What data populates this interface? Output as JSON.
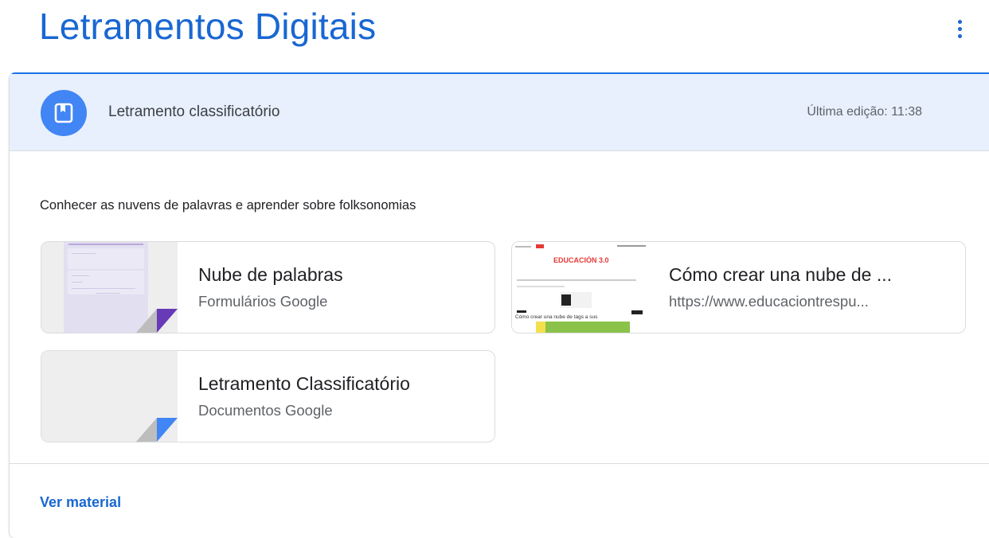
{
  "topic": {
    "title": "Letramentos Digitais"
  },
  "material": {
    "title": "Letramento classificatório",
    "last_edit": "Última edição: 11:38",
    "description": "Conhecer as nuvens de palavras e aprender sobre folksonomias",
    "view_label": "Ver material",
    "icon": "book-icon"
  },
  "attachments": [
    {
      "title": "Nube de palabras",
      "subtitle": "Formulários Google",
      "type": "google-forms",
      "corner_color": "#673ab7"
    },
    {
      "title": "Cómo crear una nube de ...",
      "subtitle": "https://www.educaciontrespu...",
      "type": "link",
      "thumb_heading": "EDUCACIÓN 3.0",
      "thumb_text": "Cómo crear una nube de tags a sus"
    },
    {
      "title": "Letramento Classificatório",
      "subtitle": "Documentos Google",
      "type": "google-docs",
      "corner_color": "#4285f4"
    }
  ],
  "colors": {
    "accent": "#1967d2",
    "header_bg": "#e8f0fe",
    "icon_bg": "#4285f4"
  }
}
